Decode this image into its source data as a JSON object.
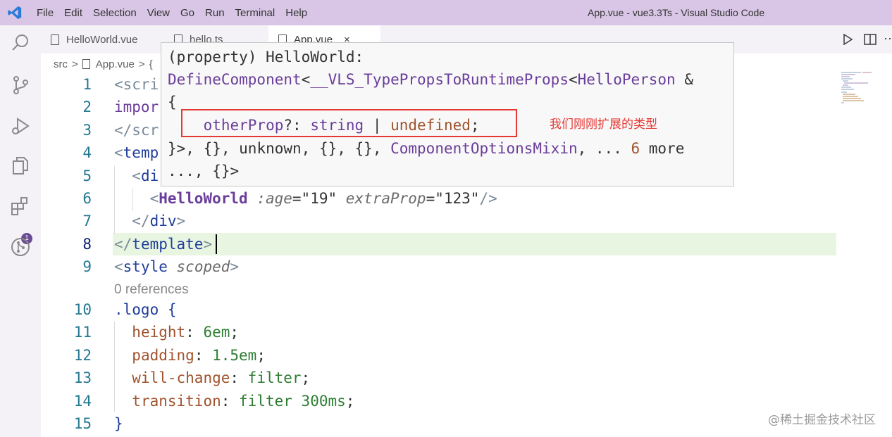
{
  "titlebar": {
    "menu": [
      "File",
      "Edit",
      "Selection",
      "View",
      "Go",
      "Run",
      "Terminal",
      "Help"
    ],
    "window_title": "App.vue - vue3.3Ts - Visual Studio Code"
  },
  "activity_bar": {
    "extensions_badge": "1"
  },
  "tabs": [
    {
      "label": "HelloWorld.vue",
      "active": false
    },
    {
      "label": "hello.ts",
      "active": false
    },
    {
      "label": "App.vue",
      "active": true,
      "close": "×"
    }
  ],
  "breadcrumb": {
    "folder": "src",
    "file": "App.vue",
    "sep": ">",
    "symbol": "{"
  },
  "editor": {
    "line_numbers": [
      "1",
      "2",
      "3",
      "4",
      "5",
      "6",
      "7",
      "8",
      "9",
      "10",
      "11",
      "12",
      "13",
      "14",
      "15"
    ],
    "current_line": "8",
    "codelens": "0 references",
    "lines": {
      "l1": "<scri",
      "l2": "impor",
      "l3": "</scr",
      "l4_open": "<",
      "l4_tag": "temp",
      "l5_open": "  <",
      "l5_tag": "di",
      "l6_indent": "    <",
      "l6_comp": "HelloWorld",
      "l6_attr1": ":age",
      "l6_eq1": "=",
      "l6_val1": "\"19\"",
      "l6_attr2": "extraProp",
      "l6_eq2": "=",
      "l6_val2": "\"123\"",
      "l6_close": "/>",
      "l7_open": "  </",
      "l7_tag": "div",
      "l7_close": ">",
      "l8_open": "</",
      "l8_tag": "template",
      "l8_close": ">",
      "l9_open": "<",
      "l9_tag": "style",
      "l9_attr": "scoped",
      "l9_close": ">",
      "l10_sel": ".logo",
      "l10_brace": "{",
      "l11_prop": "height",
      "l11_val": "6em",
      "l12_prop": "padding",
      "l12_val": "1.5em",
      "l13_prop": "will-change",
      "l13_val": "filter",
      "l14_prop": "transition",
      "l14_val1": "filter",
      "l14_val2": "300ms",
      "l15": "}"
    }
  },
  "hover": {
    "line1_a": "(property) ",
    "line1_b": "HelloWorld",
    "line1_c": ":",
    "line2_a": "DefineComponent",
    "line2_b": "<",
    "line2_c": "__VLS_TypePropsToRuntimeProps",
    "line2_d": "<",
    "line2_e": "HelloPerson",
    "line2_f": " &",
    "line3": "{",
    "line4_a": "    otherProp",
    "line4_b": "?: ",
    "line4_c": "string",
    "line4_d": " | ",
    "line4_e": "undefined",
    "line4_f": ";",
    "line5_a": "}>, {}, ",
    "line5_b": "unknown",
    "line5_c": ", {}, {}, ",
    "line5_d": "ComponentOptionsMixin",
    "line5_e": ", ... ",
    "line5_f": "6",
    "line5_g": " more",
    "line6": "..., {}>"
  },
  "annotation": "我们刚刚扩展的类型",
  "watermark": "@稀土掘金技术社区",
  "colors": {
    "title_bar": "#d9c6e6",
    "highlight_box": "#e53935",
    "current_line_bg": "#e8f5e0"
  }
}
